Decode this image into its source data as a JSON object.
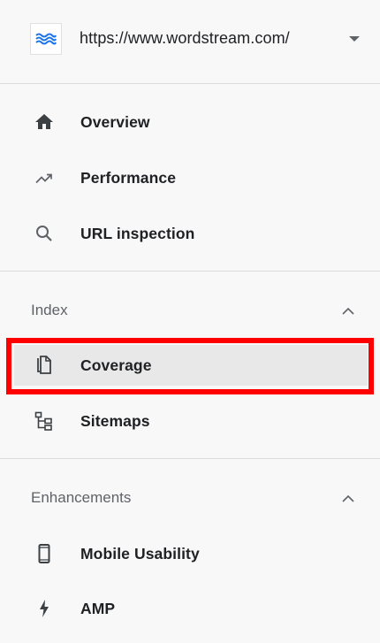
{
  "property": {
    "url": "https://www.wordstream.com/",
    "favicon_icon": "wordstream-wave-logo",
    "dropdown_icon": "caret-down-icon"
  },
  "nav_primary": [
    {
      "label": "Overview",
      "icon": "home-icon"
    },
    {
      "label": "Performance",
      "icon": "trending-up-icon"
    },
    {
      "label": "URL inspection",
      "icon": "search-icon"
    }
  ],
  "index_section": {
    "label": "Index",
    "chevron": "chevron-up-icon",
    "items": [
      {
        "label": "Coverage",
        "icon": "coverage-icon",
        "selected": true
      },
      {
        "label": "Sitemaps",
        "icon": "sitemap-icon",
        "selected": false
      }
    ]
  },
  "enhancements_section": {
    "label": "Enhancements",
    "chevron": "chevron-up-icon",
    "items": [
      {
        "label": "Mobile Usability",
        "icon": "smartphone-icon"
      },
      {
        "label": "AMP",
        "icon": "amp-bolt-icon"
      }
    ]
  },
  "colors": {
    "highlight_border": "#ff0000",
    "selected_background": "#e8e8e8",
    "favicon_blue": "#1a73e8"
  }
}
